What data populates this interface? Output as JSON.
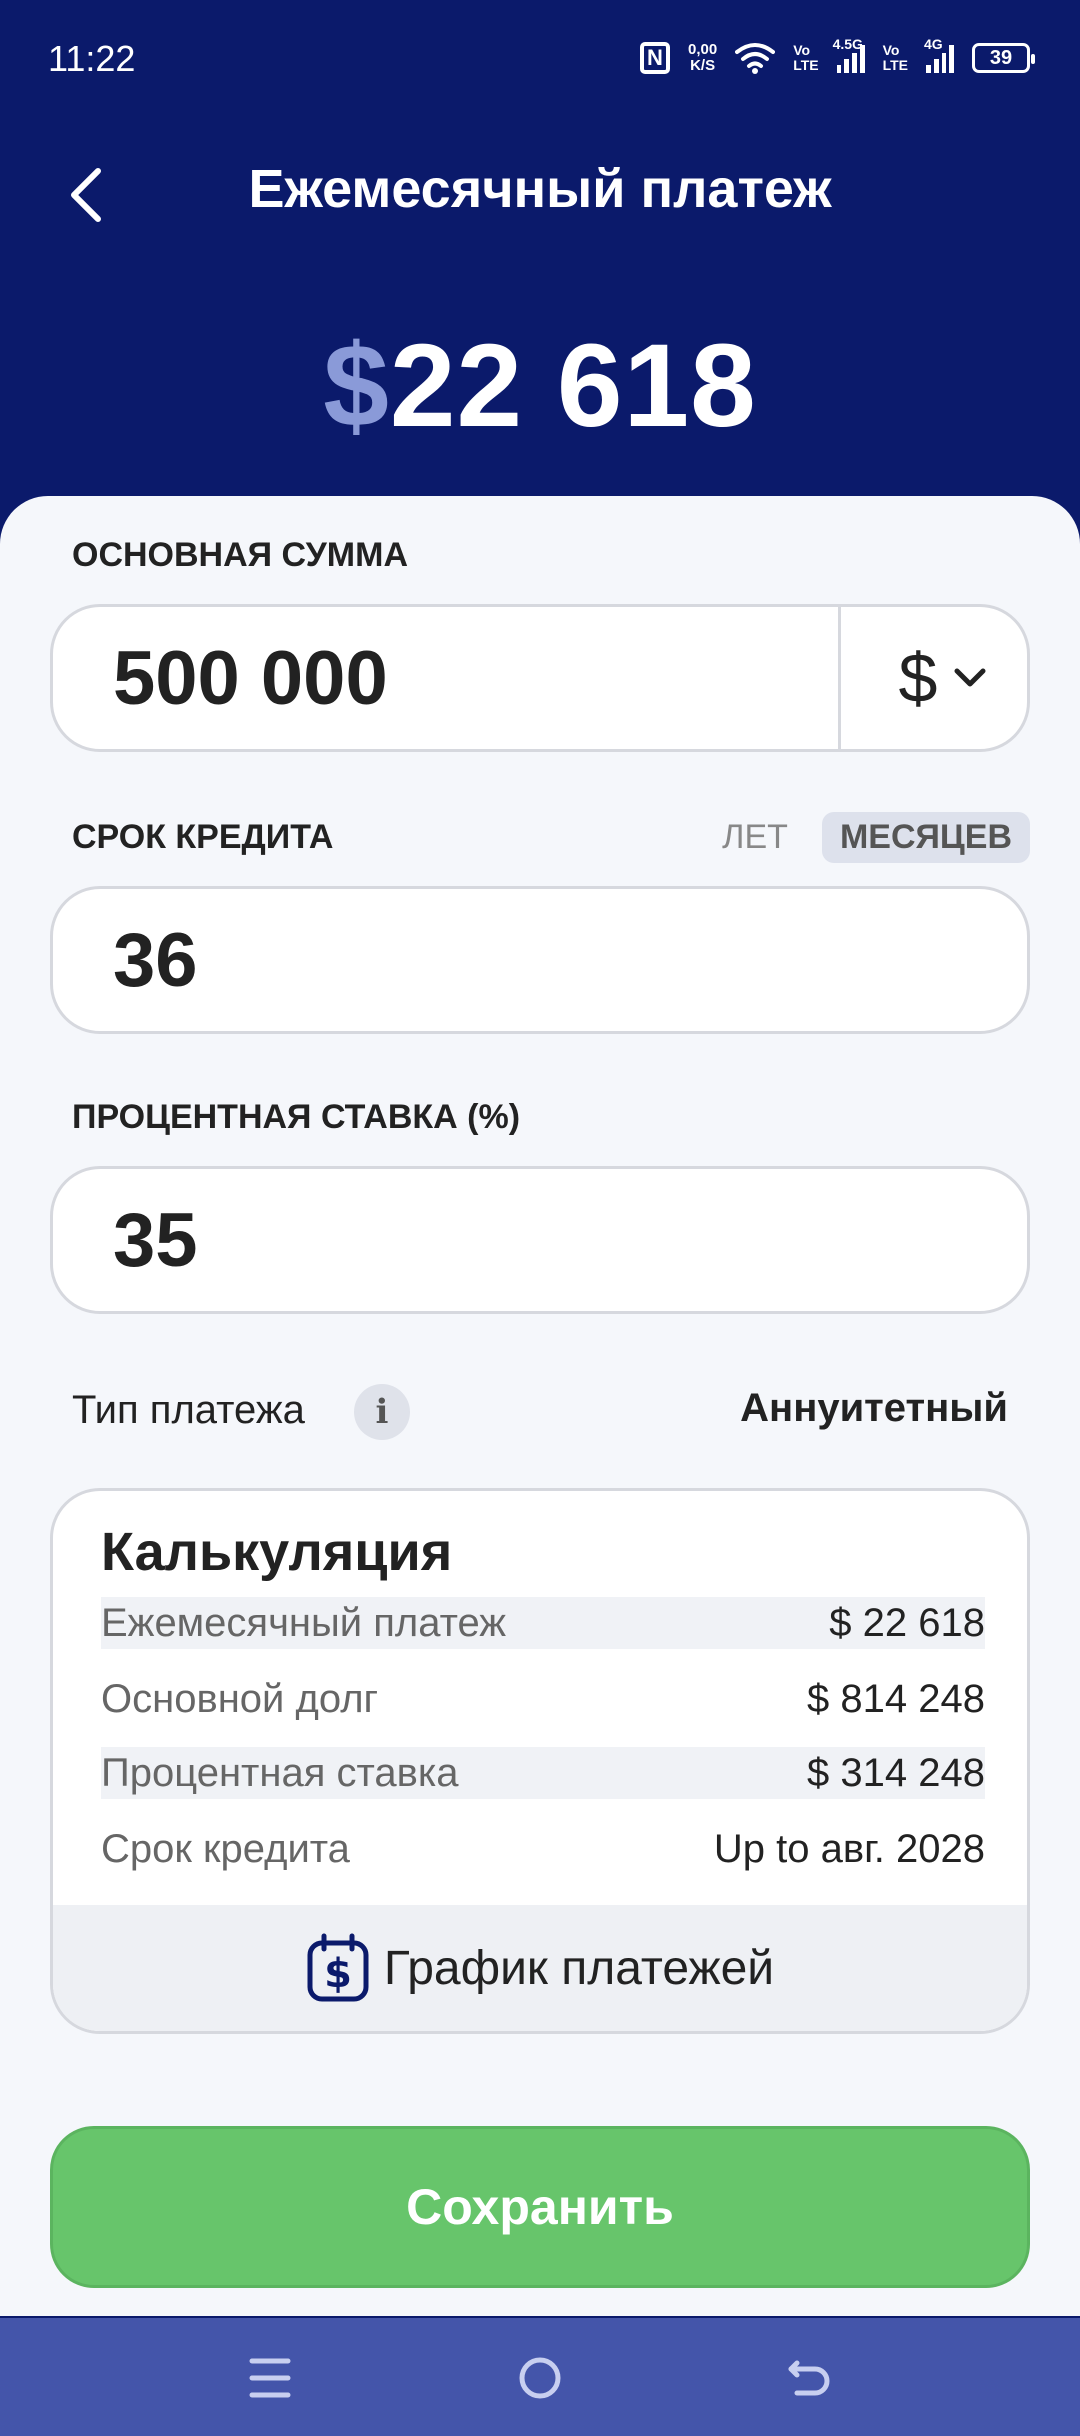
{
  "status_bar": {
    "time": "11:22",
    "speed_value": "0,00",
    "speed_unit": "K/S",
    "net1_top": "Vo",
    "net1_bottom": "LTE",
    "net1_type": "4.5G",
    "net2_top": "Vo",
    "net2_bottom": "LTE",
    "net2_type": "4G",
    "battery": "39"
  },
  "header": {
    "title": "Ежемесячный платеж",
    "amount_currency": "$",
    "amount_value": "22 618"
  },
  "principal": {
    "label": "ОСНОВНАЯ СУММА",
    "value": "500 000",
    "currency": "$"
  },
  "term": {
    "label": "СРОК КРЕДИТА",
    "unit_years": "ЛЕТ",
    "unit_months": "МЕСЯЦЕВ",
    "selected_unit": "МЕСЯЦЕВ",
    "value": "36"
  },
  "rate": {
    "label": "ПРОЦЕНТНАЯ СТАВКА (%)",
    "value": "35"
  },
  "payment_type": {
    "label": "Тип платежа",
    "info_icon": "i",
    "value": "Аннуитетный"
  },
  "calculation": {
    "title": "Калькуляция",
    "rows": [
      {
        "label": "Ежемесячный платеж",
        "value": "$ 22 618"
      },
      {
        "label": "Основной долг",
        "value": "$ 814 248"
      },
      {
        "label": "Процентная ставка",
        "value": "$ 314 248"
      },
      {
        "label": "Срок кредита",
        "value": "Up to авг. 2028"
      }
    ],
    "schedule_button": "График платежей",
    "schedule_icon_glyph": "$"
  },
  "save_button": "Сохранить",
  "colors": {
    "header_bg": "#0b1a6b",
    "accent_currency": "#8a9ad8",
    "save_green": "#67c56b",
    "nav_bg": "#4455aa"
  },
  "icons": {
    "back": "chevron-left-icon",
    "dropdown": "chevron-down-icon",
    "info": "info-icon",
    "schedule": "calendar-dollar-icon",
    "nav_menu": "menu-icon",
    "nav_home": "home-circle-icon",
    "nav_back": "back-arrow-icon"
  }
}
